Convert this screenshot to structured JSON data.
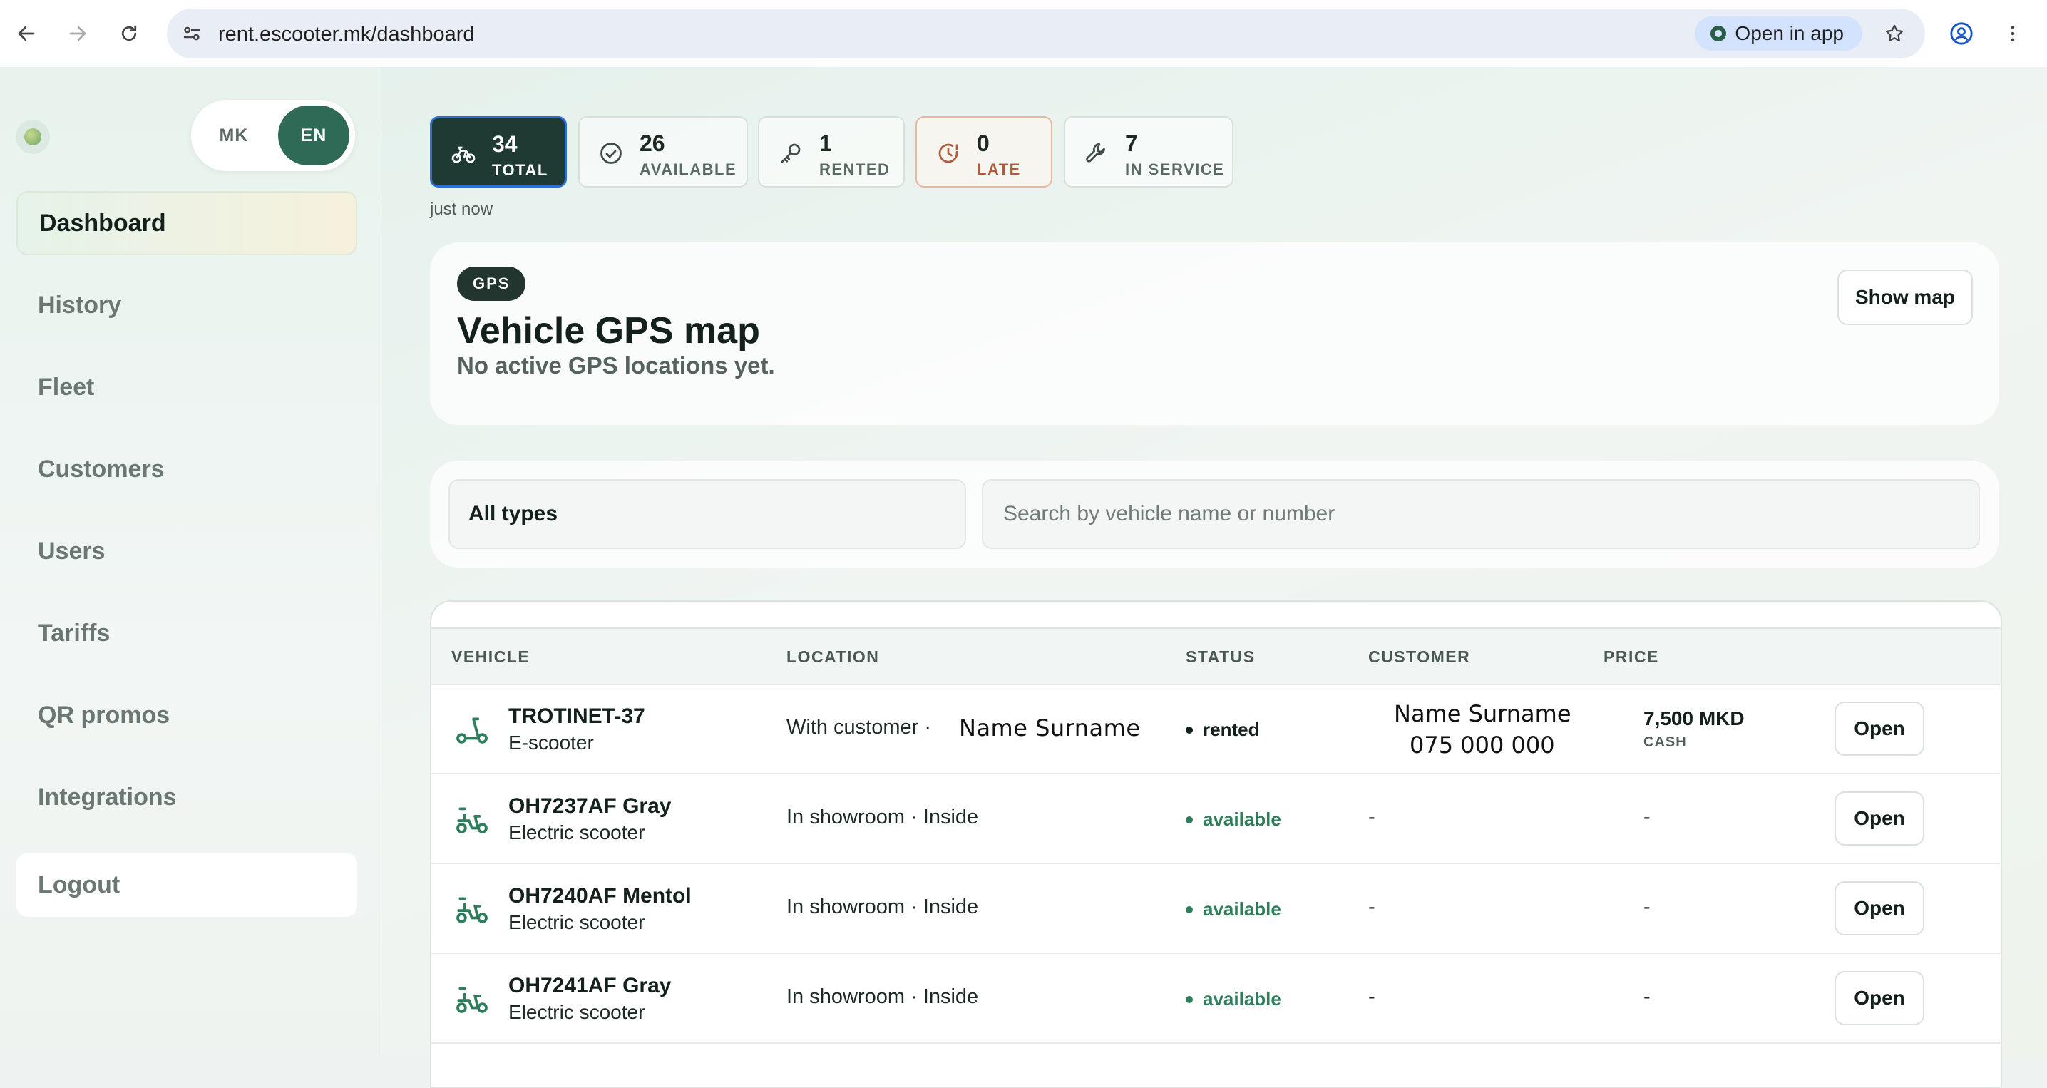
{
  "browser": {
    "url": "rent.escooter.mk/dashboard",
    "open_in_app": "Open in app"
  },
  "sidebar": {
    "lang": {
      "mk": "MK",
      "en": "EN",
      "selected": "EN"
    },
    "items": [
      {
        "label": "Dashboard",
        "active": true
      },
      {
        "label": "History"
      },
      {
        "label": "Fleet"
      },
      {
        "label": "Customers"
      },
      {
        "label": "Users"
      },
      {
        "label": "Tariffs"
      },
      {
        "label": "QR promos"
      },
      {
        "label": "Integrations"
      }
    ],
    "logout": "Logout"
  },
  "stats": {
    "total": {
      "value": "34",
      "label": "TOTAL"
    },
    "available": {
      "value": "26",
      "label": "AVAILABLE"
    },
    "rented": {
      "value": "1",
      "label": "RENTED"
    },
    "late": {
      "value": "0",
      "label": "LATE"
    },
    "in_service": {
      "value": "7",
      "label": "IN SERVICE"
    },
    "updated": "just now"
  },
  "gps": {
    "badge": "GPS",
    "title": "Vehicle GPS map",
    "subtitle": "No active GPS locations yet.",
    "show_map": "Show map"
  },
  "filters": {
    "type_selected": "All types",
    "search_placeholder": "Search by vehicle name or number"
  },
  "table": {
    "headers": {
      "vehicle": "VEHICLE",
      "location": "LOCATION",
      "status": "STATUS",
      "customer": "CUSTOMER",
      "price": "PRICE"
    },
    "open_label": "Open",
    "rows": [
      {
        "name": "TROTINET-37",
        "type": "E-scooter",
        "location": "With customer ·",
        "location_name": "Name Surname",
        "status": "rented",
        "customer_name": "Name Surname",
        "customer_phone": "075 000 000",
        "price": "7,500 MKD",
        "price_method": "CASH"
      },
      {
        "name": "OH7237AF Gray",
        "type": "Electric scooter",
        "location": "In showroom · Inside",
        "status": "available",
        "customer": "-",
        "price": "-"
      },
      {
        "name": "OH7240AF Mentol",
        "type": "Electric scooter",
        "location": "In showroom · Inside",
        "status": "available",
        "customer": "-",
        "price": "-"
      },
      {
        "name": "OH7241AF Gray",
        "type": "Electric scooter",
        "location": "In showroom · Inside",
        "status": "available",
        "customer": "-",
        "price": "-"
      }
    ]
  },
  "colors": {
    "accent": "#2e6a55",
    "status_available": "#2e7d5b",
    "status_rented": "#13201b",
    "late": "#b05b3b"
  }
}
